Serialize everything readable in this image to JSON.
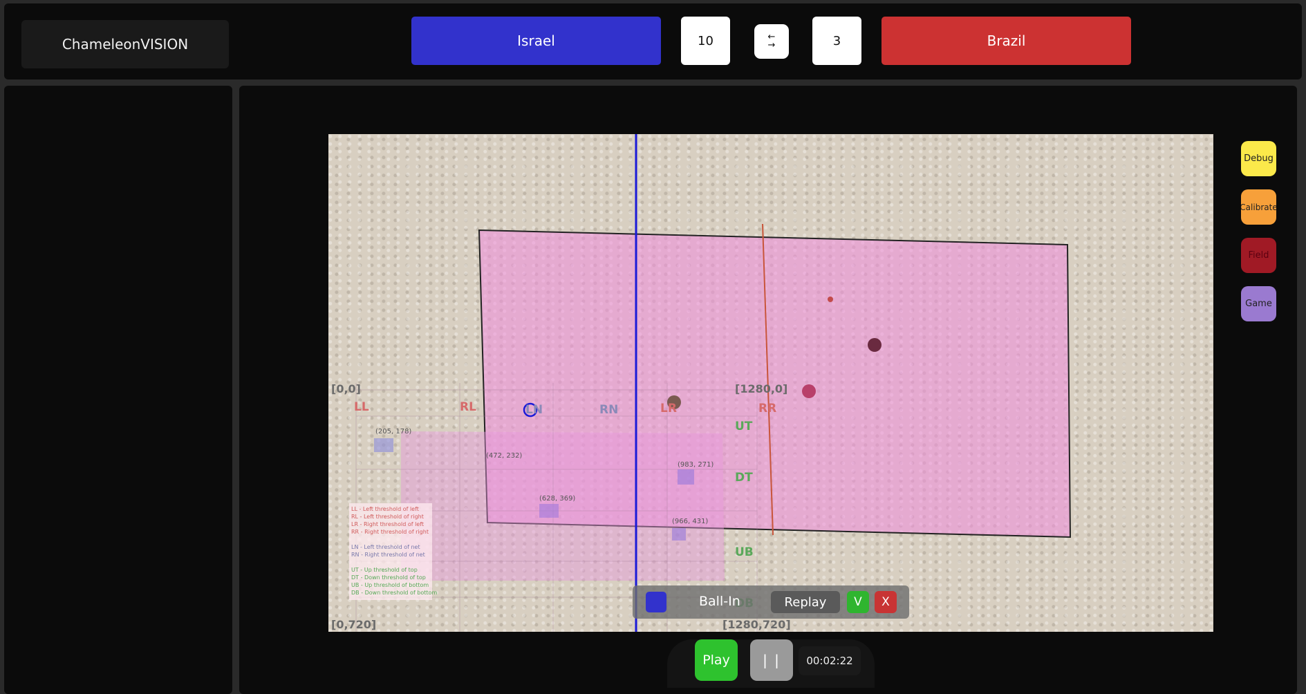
{
  "app": {
    "title": "ChameleonVISION"
  },
  "header": {
    "team_left": {
      "name": "Israel",
      "color": "#3232cc",
      "score": "10"
    },
    "team_right": {
      "name": "Brazil",
      "color": "#cc3232",
      "score": "3"
    },
    "swap_icon": "swap-arrows-icon",
    "swap_glyph": "←\n→"
  },
  "video": {
    "corner_labels": {
      "top_left": "[0,0]",
      "top_right": "[1280,0]",
      "bottom_left": "[0,720]",
      "bottom_right": "[1280,720]"
    },
    "zones_red": [
      "LL",
      "RL",
      "LR",
      "RR"
    ],
    "zones_blue": [
      "LN",
      "RN"
    ],
    "zones_green": [
      "UT",
      "DT",
      "UB",
      "DB"
    ],
    "points": [
      "(205, 178)",
      "(472, 232)",
      "(628, 369)",
      "(983, 271)",
      "(966, 431)"
    ],
    "legend": [
      "LL - Left threshold of left",
      "RL - Left threshold of right",
      "LR - Right threshold of left",
      "RR - Right threshold of right",
      "LN - Left threshold of net",
      "RN - Right threshold of net",
      "UT - Up threshold of top",
      "DT - Down threshold of top",
      "UB - Up threshold of bottom",
      "DB - Down threshold of bottom"
    ]
  },
  "side_buttons": {
    "debug": {
      "label": "Debug",
      "color": "#fbe94a"
    },
    "calibrate": {
      "label": "Calibrate",
      "color": "#f7a03a"
    },
    "field": {
      "label": "Field",
      "color": "#a01a25"
    },
    "game": {
      "label": "Game",
      "color": "#9a7ad0"
    }
  },
  "overlay": {
    "ball_in": "Ball-In",
    "replay": "Replay",
    "confirm": "V",
    "reject": "X"
  },
  "player": {
    "play": "Play",
    "pause": "| |",
    "time": "00:02:22"
  }
}
